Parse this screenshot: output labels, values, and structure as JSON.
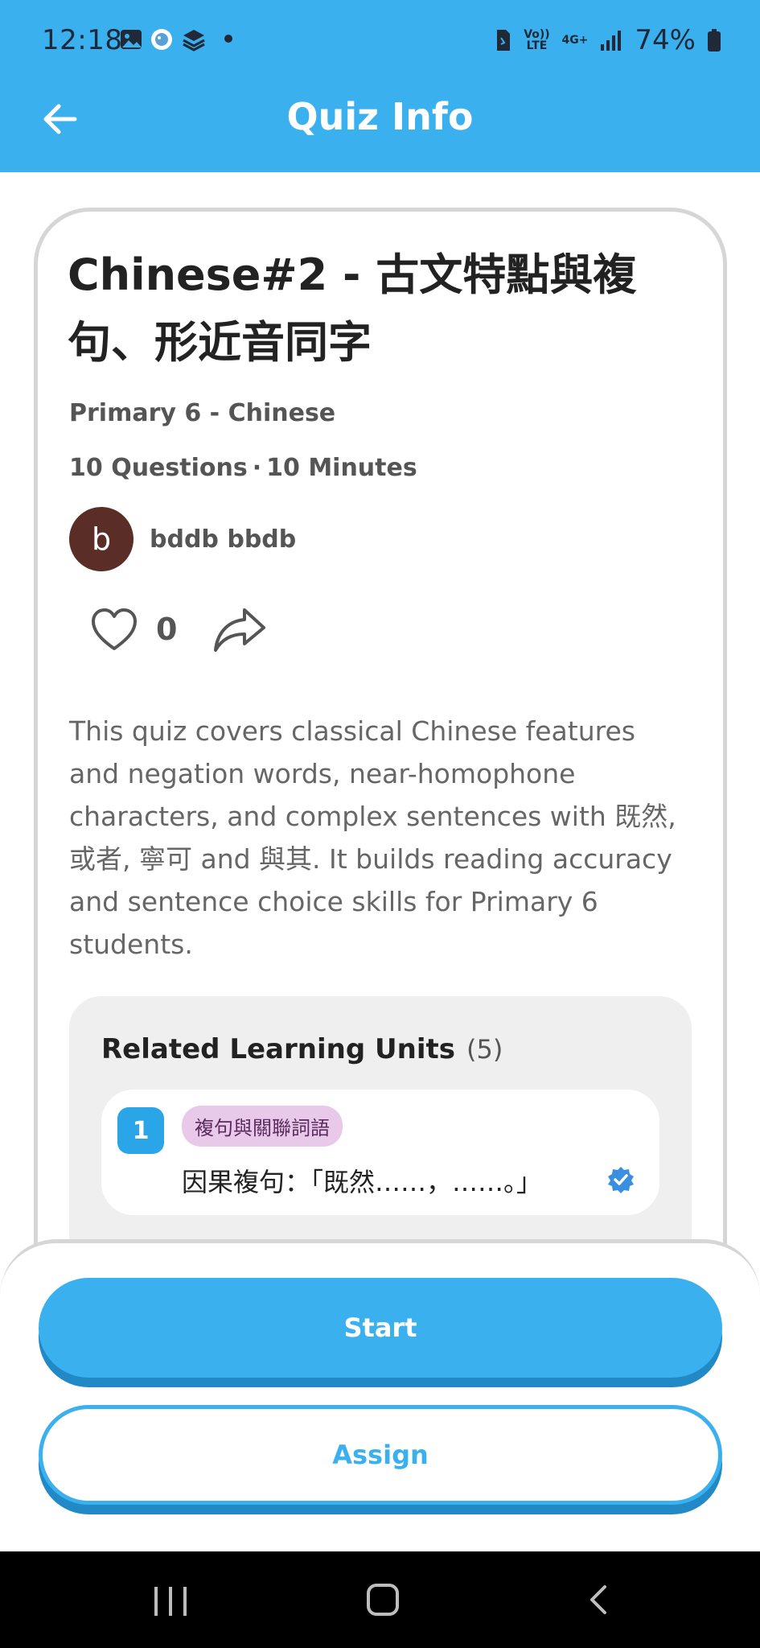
{
  "status_bar": {
    "time": "12:18",
    "network_top": "Vo)) LTE",
    "network_type": "4G+",
    "battery": "74%"
  },
  "header": {
    "title": "Quiz Info",
    "back_icon": "arrow-left-icon"
  },
  "quiz": {
    "title": "Chinese#2 - 古文特點與複句、形近音同字",
    "subject": "Primary 6 - Chinese",
    "questions": "10 Questions",
    "separator": "·",
    "duration": "10 Minutes",
    "author_initial": "b",
    "author_name": "bddb bbdb",
    "likes": "0",
    "description": "This quiz covers classical Chinese features and negation words, near-homophone characters, and complex sentences with 既然, 或者, 寧可 and 與其. It builds reading accuracy and sentence choice skills for Primary 6 students."
  },
  "related": {
    "title": "Related Learning Units",
    "count": "(5)",
    "units": [
      {
        "number": "1",
        "tag": "複句與關聯詞語",
        "text": "因果複句：「既然……，……。」"
      }
    ]
  },
  "buttons": {
    "start": "Start",
    "assign": "Assign"
  },
  "colors": {
    "primary": "#3ab0ee",
    "primary_shadow": "#2289c7",
    "avatar": "#5a2d27",
    "tag_bg": "#e9c9ea"
  }
}
